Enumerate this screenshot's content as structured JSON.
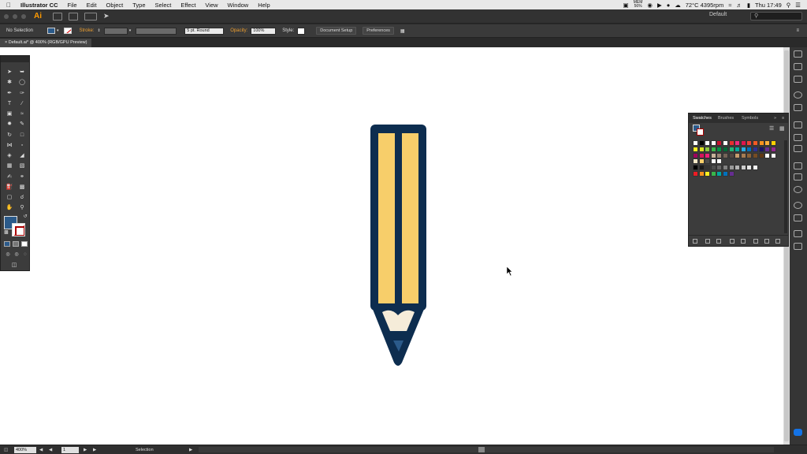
{
  "menubar": {
    "app_name": "Illustrator CC",
    "items": [
      "File",
      "Edit",
      "Object",
      "Type",
      "Select",
      "Effect",
      "View",
      "Window",
      "Help"
    ],
    "mem_top": "MEM",
    "mem_value": "56%",
    "temp": "72°C 4395rpm",
    "clock": "Thu 17:49"
  },
  "appbar": {
    "logo": "Ai",
    "workspace": "Default",
    "search_placeholder": ""
  },
  "controlbar": {
    "selection": "No Selection",
    "stroke_label": "Stroke:",
    "brush": "5 pt. Round",
    "opacity_label": "Opacity:",
    "opacity_value": "100%",
    "style_label": "Style:",
    "document_setup": "Document Setup",
    "preferences": "Preferences"
  },
  "document": {
    "tab": "Default.ai* @ 400% (RGB/GPU Preview)"
  },
  "swatches": {
    "tabs": [
      "Swatches",
      "Brushes",
      "Symbols"
    ],
    "rows": [
      [
        "#ffffff",
        "#000000",
        "#ffffff",
        "#ffffff",
        "#c8102e",
        "#ffffff",
        "#e62e2e",
        "#ee2a7b",
        "#e0144c",
        "#ef4136",
        "#f15a24",
        "#f7931e",
        "#fbb03b",
        "#ffd200"
      ],
      [
        "#fcee21",
        "#d9e021",
        "#8cc63f",
        "#39b54a",
        "#009245",
        "#006837",
        "#22b573",
        "#00a99d",
        "#29abe2",
        "#0071bc",
        "#2e3192",
        "#1b1464",
        "#662d91",
        "#93278f"
      ],
      [
        "#9e005d",
        "#d4145a",
        "#ed1e79",
        "#c7b299",
        "#998675",
        "#736357",
        "#534741",
        "#c69c6d",
        "#a67c52",
        "#8c6239",
        "#754c24",
        "#603813",
        "#ffffff",
        "#ffffff"
      ],
      [
        "#f5e8c8",
        "#f7ce6a",
        "#4a4a4a",
        "#ffffff",
        "#ffffff"
      ],
      [
        "#000000",
        "#1a1a1a",
        "#333333",
        "#4d4d4d",
        "#666666",
        "#808080",
        "#999999",
        "#b3b3b3",
        "#cccccc",
        "#e6e6e6",
        "#f2f2f2"
      ],
      [
        "#ed1c24",
        "#f7931e",
        "#fcee21",
        "#39b54a",
        "#00a99d",
        "#0071bc",
        "#662d91"
      ]
    ]
  },
  "pencil": {
    "outline": "#0d2d4f",
    "body": "#f7ce6a",
    "wood": "#f5ecd9",
    "tip": "#2b5a8a"
  },
  "colors": {
    "fill": "#2b5a8a",
    "accent": "#ff9a00"
  },
  "statusbar": {
    "zoom": "400%",
    "page": "1",
    "tool": "Selection"
  }
}
